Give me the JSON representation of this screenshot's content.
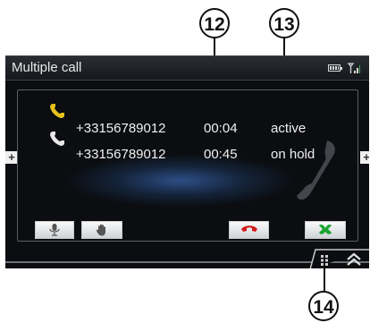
{
  "screen": {
    "title": "Multiple call"
  },
  "callouts": [
    {
      "number": "12"
    },
    {
      "number": "13"
    },
    {
      "number": "14"
    }
  ],
  "calls": [
    {
      "number": "+33156789012",
      "duration": "00:04",
      "status": "active",
      "icon": "phone-active-icon"
    },
    {
      "number": "+33156789012",
      "duration": "00:45",
      "status": "on hold",
      "icon": "phone-hold-icon"
    }
  ],
  "side_buttons": {
    "left": "+",
    "right": "+"
  },
  "controls": [
    {
      "name": "mute-microphone-button",
      "icon": "microphone-icon"
    },
    {
      "name": "hold-hand-button",
      "icon": "hand-icon"
    },
    {
      "name": "hang-up-button",
      "icon": "end-call-icon",
      "color": "#d41a1a"
    },
    {
      "name": "swap-calls-button",
      "icon": "swap-calls-icon",
      "color": "#1aa332"
    }
  ],
  "colors": {
    "active_phone": "#e7c21a",
    "hold_phone": "#e8e8e8",
    "hang_up": "#d41a1a",
    "swap": "#1aa332"
  }
}
